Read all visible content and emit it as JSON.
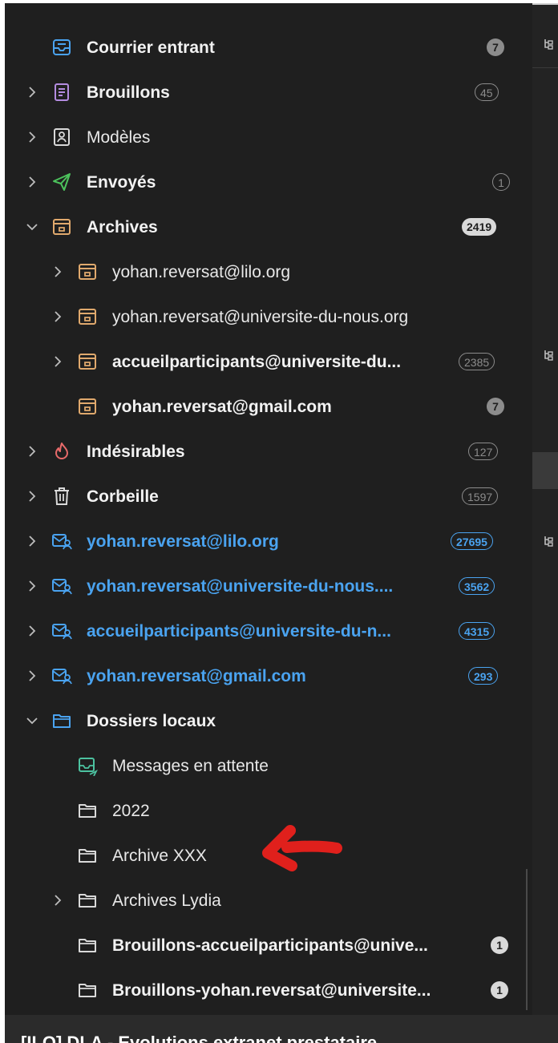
{
  "folders": [
    {
      "label": "Courrier entrant",
      "badge": "7"
    },
    {
      "label": "Brouillons",
      "badge": "45"
    },
    {
      "label": "Modèles",
      "badge": ""
    },
    {
      "label": "Envoyés",
      "badge": "1"
    },
    {
      "label": "Archives",
      "badge": "2419"
    },
    {
      "label": "yohan.reversat@lilo.org",
      "badge": ""
    },
    {
      "label": "yohan.reversat@universite-du-nous.org",
      "badge": ""
    },
    {
      "label": "accueilparticipants@universite-du...",
      "badge": "2385"
    },
    {
      "label": "yohan.reversat@gmail.com",
      "badge": "7"
    },
    {
      "label": "Indésirables",
      "badge": "127"
    },
    {
      "label": "Corbeille",
      "badge": "1597"
    },
    {
      "label": "yohan.reversat@lilo.org",
      "badge": "27695"
    },
    {
      "label": "yohan.reversat@universite-du-nous....",
      "badge": "3562"
    },
    {
      "label": "accueilparticipants@universite-du-n...",
      "badge": "4315"
    },
    {
      "label": "yohan.reversat@gmail.com",
      "badge": "293"
    },
    {
      "label": "Dossiers locaux",
      "badge": ""
    },
    {
      "label": "Messages en attente",
      "badge": ""
    },
    {
      "label": "2022",
      "badge": ""
    },
    {
      "label": "Archive XXX",
      "badge": ""
    },
    {
      "label": "Archives Lydia",
      "badge": ""
    },
    {
      "label": "Brouillons-accueilparticipants@unive...",
      "badge": "1"
    },
    {
      "label": "Brouillons-yohan.reversat@universite...",
      "badge": "1"
    }
  ],
  "message_preview": {
    "subject": "[ILO] DLA - Evolutions extranet prestataire"
  },
  "colors": {
    "pane_bg": "#1f1f1f",
    "account_blue": "#4aa3f0",
    "annotation_red": "#e0201c"
  },
  "icons": [
    "inbox-icon",
    "drafts-icon",
    "templates-icon",
    "sent-icon",
    "archive-icon",
    "junk-icon",
    "trash-icon",
    "account-icon",
    "folder-icon",
    "outbox-icon",
    "chevron-right-icon",
    "chevron-down-icon",
    "thread-icon"
  ]
}
